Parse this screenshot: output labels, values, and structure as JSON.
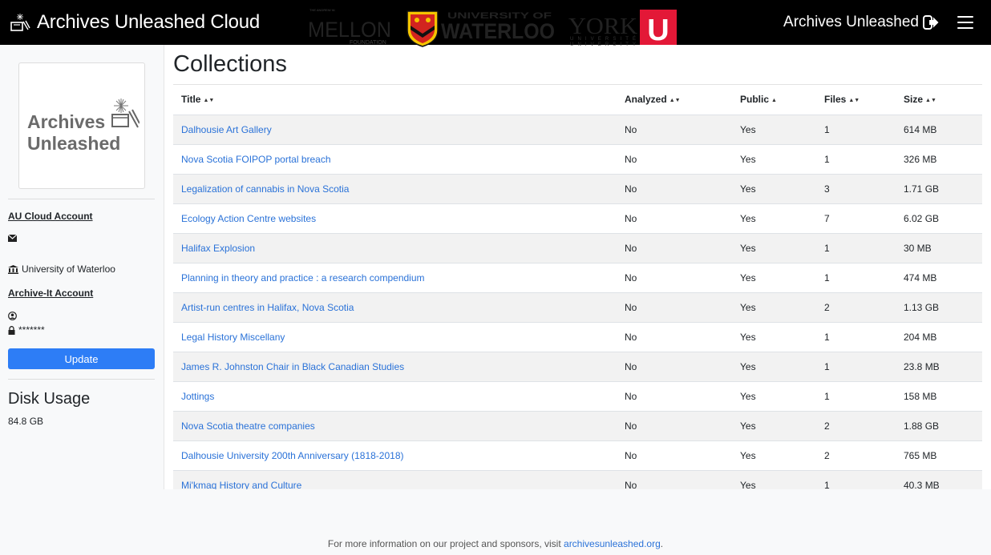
{
  "navbar": {
    "brand": "Archives Unleashed Cloud",
    "user": "Archives Unleashed"
  },
  "sidebar": {
    "logo_line1": "Archives",
    "logo_line2": "Unleashed",
    "au_account_label": "AU Cloud Account",
    "email": "",
    "institution": "University of Waterloo",
    "archive_it_label": "Archive-It Account",
    "archive_it_user": "",
    "password": "*******",
    "update_label": "Update",
    "disk_title": "Disk Usage",
    "disk_value": "84.8 GB"
  },
  "main": {
    "title": "Collections",
    "columns": [
      "Title",
      "Analyzed",
      "Public",
      "Files",
      "Size"
    ],
    "rows": [
      {
        "title": "Dalhousie Art Gallery",
        "analyzed": "No",
        "public": "Yes",
        "files": "1",
        "size": "614 MB"
      },
      {
        "title": "Nova Scotia FOIPOP portal breach",
        "analyzed": "No",
        "public": "Yes",
        "files": "1",
        "size": "326 MB"
      },
      {
        "title": "Legalization of cannabis in Nova Scotia",
        "analyzed": "No",
        "public": "Yes",
        "files": "3",
        "size": "1.71 GB"
      },
      {
        "title": "Ecology Action Centre websites",
        "analyzed": "No",
        "public": "Yes",
        "files": "7",
        "size": "6.02 GB"
      },
      {
        "title": "Halifax Explosion",
        "analyzed": "No",
        "public": "Yes",
        "files": "1",
        "size": "30 MB"
      },
      {
        "title": "Planning in theory and practice : a research compendium",
        "analyzed": "No",
        "public": "Yes",
        "files": "1",
        "size": "474 MB"
      },
      {
        "title": "Artist-run centres in Halifax, Nova Scotia",
        "analyzed": "No",
        "public": "Yes",
        "files": "2",
        "size": "1.13 GB"
      },
      {
        "title": "Legal History Miscellany",
        "analyzed": "No",
        "public": "Yes",
        "files": "1",
        "size": "204 MB"
      },
      {
        "title": "James R. Johnston Chair in Black Canadian Studies",
        "analyzed": "No",
        "public": "Yes",
        "files": "1",
        "size": "23.8 MB"
      },
      {
        "title": "Jottings",
        "analyzed": "No",
        "public": "Yes",
        "files": "1",
        "size": "158 MB"
      },
      {
        "title": "Nova Scotia theatre companies",
        "analyzed": "No",
        "public": "Yes",
        "files": "2",
        "size": "1.88 GB"
      },
      {
        "title": "Dalhousie University 200th Anniversary (1818-2018)",
        "analyzed": "No",
        "public": "Yes",
        "files": "2",
        "size": "765 MB"
      },
      {
        "title": "Mi'kmaq History and Culture",
        "analyzed": "No",
        "public": "Yes",
        "files": "1",
        "size": "40.3 MB"
      }
    ]
  },
  "footer": {
    "mellon_small": "THE ANDREW W.",
    "mellon": "MELLON",
    "mellon_sub": "FOUNDATION",
    "waterloo_top": "UNIVERSITY OF",
    "waterloo": "WATERLOO",
    "york": "YORK",
    "york_sub1": "UNIVERSITÉ",
    "york_sub2": "UNIVERSITY",
    "york_u": "U",
    "text": "For more information on our project and sponsors, visit ",
    "link": "archivesunleashed.org",
    "text_end": "."
  }
}
